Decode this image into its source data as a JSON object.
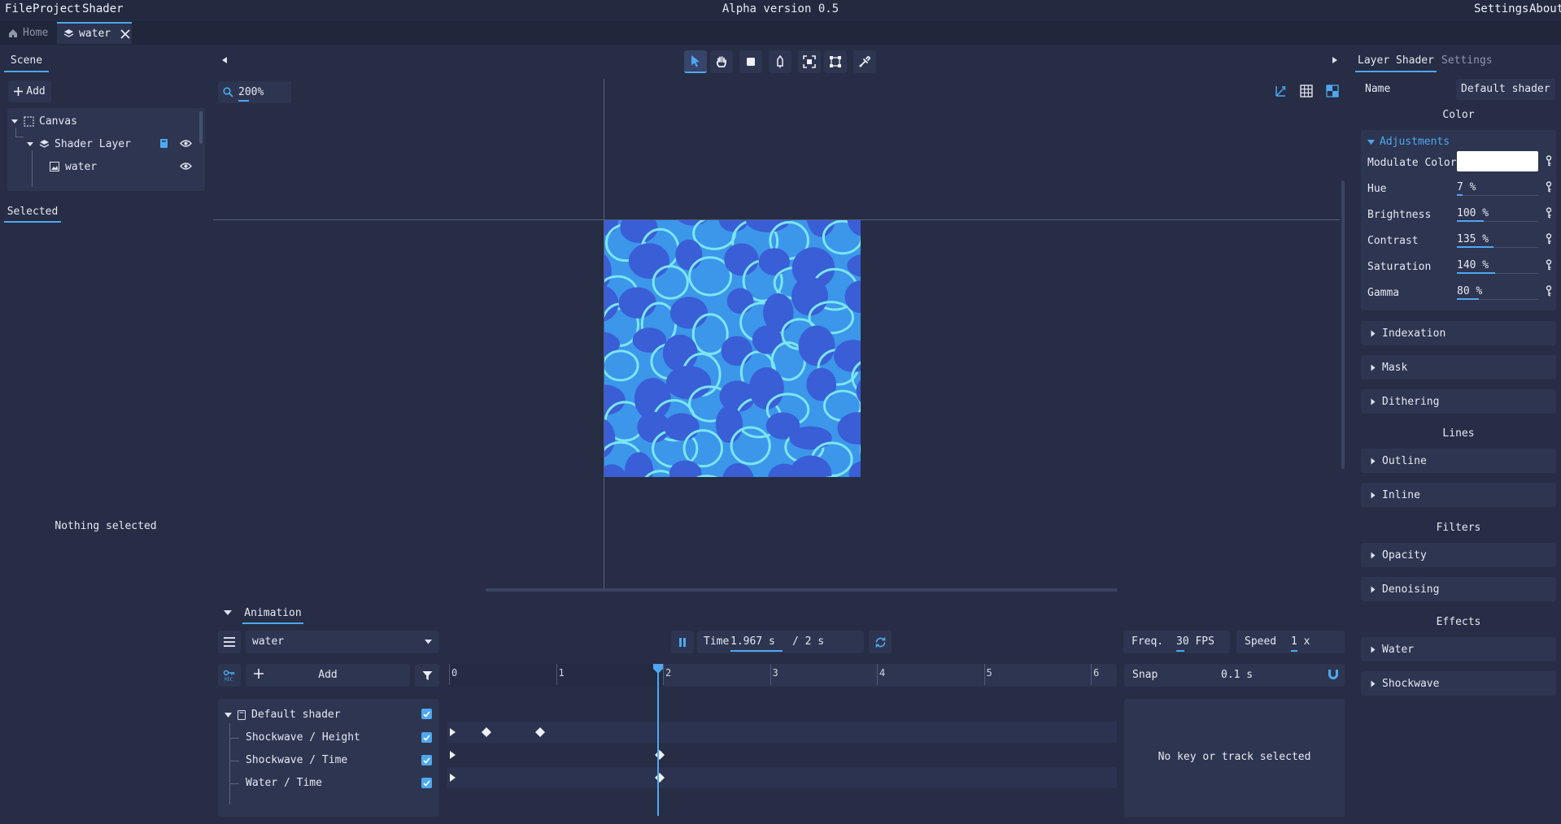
{
  "menu": {
    "file": "File",
    "project": "Project",
    "shader": "Shader",
    "settings": "Settings",
    "about": "About"
  },
  "app_title": "Alpha version 0.5",
  "tabs": [
    {
      "label": "Home"
    },
    {
      "label": "water"
    }
  ],
  "scene": {
    "tab_label": "Scene",
    "add_label": "Add",
    "tree": [
      {
        "label": "Canvas"
      },
      {
        "label": "Shader Layer"
      },
      {
        "label": "water"
      }
    ],
    "selected_tab": "Selected",
    "nothing_selected": "Nothing selected"
  },
  "viewport": {
    "zoom": "200%",
    "tools": [
      "select-arrow-icon",
      "hand-pan-icon",
      "rectangle-icon",
      "pen-icon",
      "focus-frame-icon",
      "transform-icon",
      "eyedropper-icon"
    ]
  },
  "right_panel": {
    "tab_layer_shader": "Layer Shader",
    "tab_settings": "Settings",
    "name_label": "Name",
    "name_value": "Default shader",
    "color_heading": "Color",
    "adjustments_label": "Adjustments",
    "adjustments": [
      {
        "label": "Modulate Color",
        "value": ""
      },
      {
        "label": "Hue",
        "value": "7 %",
        "fill": 0.07
      },
      {
        "label": "Brightness",
        "value": "100 %",
        "fill": 0.33
      },
      {
        "label": "Contrast",
        "value": "135 %",
        "fill": 0.45
      },
      {
        "label": "Saturation",
        "value": "140 %",
        "fill": 0.47
      },
      {
        "label": "Gamma",
        "value": "80 %",
        "fill": 0.27
      }
    ],
    "modulate_color": "#ffffff",
    "color_sections": [
      "Indexation",
      "Mask",
      "Dithering"
    ],
    "lines_heading": "Lines",
    "lines_sections": [
      "Outline",
      "Inline"
    ],
    "filters_heading": "Filters",
    "filters_sections": [
      "Opacity",
      "Denoising"
    ],
    "effects_heading": "Effects",
    "effects_sections": [
      "Water",
      "Shockwave"
    ]
  },
  "animation": {
    "tab_label": "Animation",
    "animation_name": "water",
    "add_label": "Add",
    "time_label": "Time",
    "time_value": "1.967 s",
    "time_total": "/ 2 s",
    "freq_label": "Freq.",
    "freq_value": "30 FPS",
    "speed_label": "Speed",
    "speed_value": "1 x",
    "snap_label": "Snap",
    "snap_value": "0.1 s",
    "ruler": [
      "0",
      "1",
      "2",
      "3",
      "4",
      "5",
      "6"
    ],
    "tracks_group": "Default shader",
    "tracks": [
      {
        "label": "Shockwave / Height",
        "keys": [
          0.35,
          0.85
        ]
      },
      {
        "label": "Shockwave / Time",
        "keys": [
          1.967
        ]
      },
      {
        "label": "Water / Time",
        "keys": [
          1.967
        ]
      }
    ],
    "no_selection": "No key or track selected"
  }
}
